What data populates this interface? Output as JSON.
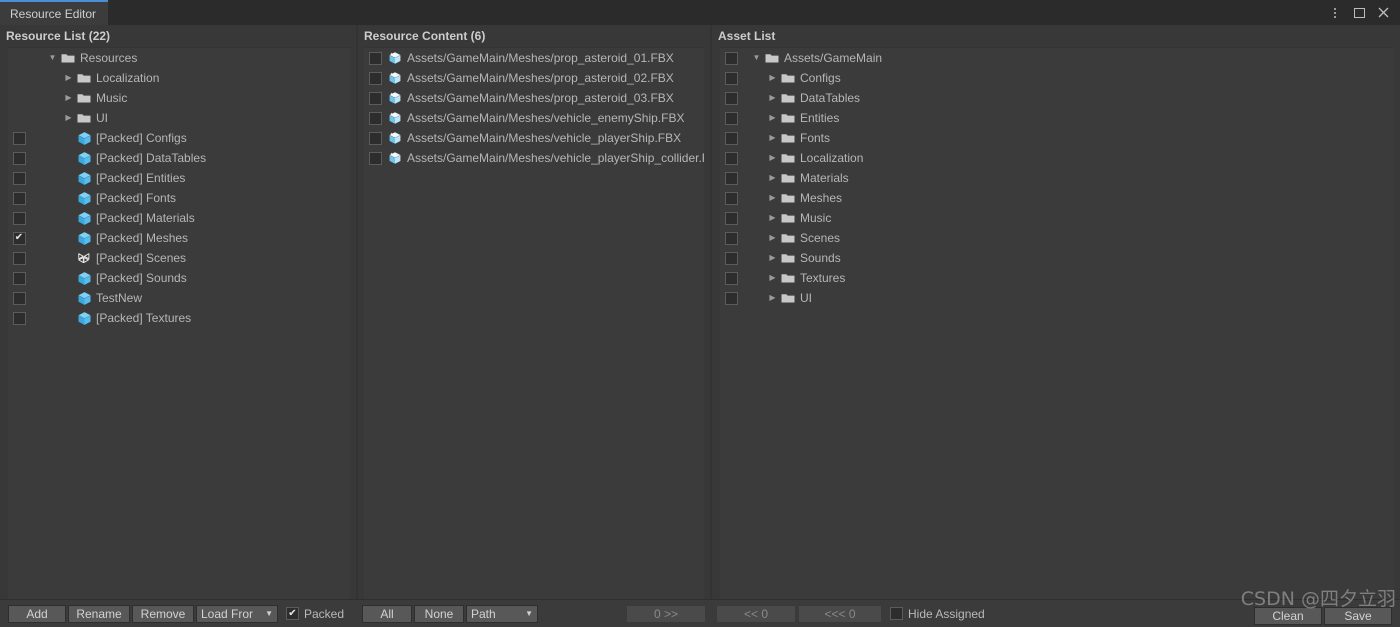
{
  "window": {
    "tab_label": "Resource Editor",
    "accent_color": "#4a8fd6",
    "controls": [
      {
        "name": "more-options",
        "glyph": "kebab"
      },
      {
        "name": "maximize",
        "glyph": "square"
      },
      {
        "name": "close",
        "glyph": "✕"
      }
    ]
  },
  "panels": {
    "resource_list": {
      "title": "Resource List (22)",
      "rows": [
        {
          "label": "Resources",
          "icon": "folder-icon",
          "indent": 1,
          "triangle": "down",
          "checkbox": null
        },
        {
          "label": "Localization",
          "icon": "folder-icon",
          "indent": 2,
          "triangle": "right",
          "checkbox": null
        },
        {
          "label": "Music",
          "icon": "folder-icon",
          "indent": 2,
          "triangle": "right",
          "checkbox": null
        },
        {
          "label": "UI",
          "icon": "folder-icon",
          "indent": 2,
          "triangle": "right",
          "checkbox": null
        },
        {
          "label": "[Packed] Configs",
          "icon": "prefab-icon",
          "indent": 2,
          "triangle": "none",
          "checkbox": false
        },
        {
          "label": "[Packed] DataTables",
          "icon": "prefab-icon",
          "indent": 2,
          "triangle": "none",
          "checkbox": false
        },
        {
          "label": "[Packed] Entities",
          "icon": "prefab-icon",
          "indent": 2,
          "triangle": "none",
          "checkbox": false
        },
        {
          "label": "[Packed] Fonts",
          "icon": "prefab-icon",
          "indent": 2,
          "triangle": "none",
          "checkbox": false
        },
        {
          "label": "[Packed] Materials",
          "icon": "prefab-icon",
          "indent": 2,
          "triangle": "none",
          "checkbox": false
        },
        {
          "label": "[Packed] Meshes",
          "icon": "prefab-icon",
          "indent": 2,
          "triangle": "none",
          "checkbox": true
        },
        {
          "label": "[Packed] Scenes",
          "icon": "unity-icon",
          "indent": 2,
          "triangle": "none",
          "checkbox": false
        },
        {
          "label": "[Packed] Sounds",
          "icon": "prefab-icon",
          "indent": 2,
          "triangle": "none",
          "checkbox": false
        },
        {
          "label": "TestNew",
          "icon": "prefab-icon",
          "indent": 2,
          "triangle": "none",
          "checkbox": false
        },
        {
          "label": "[Packed] Textures",
          "icon": "prefab-icon",
          "indent": 2,
          "triangle": "none",
          "checkbox": false
        }
      ],
      "toolbar": {
        "add_label": "Add",
        "rename_label": "Rename",
        "remove_label": "Remove",
        "load_from_label": "Load Fror",
        "packed_label": "Packed",
        "packed_checked": true
      }
    },
    "resource_content": {
      "title": "Resource Content (6)",
      "rows": [
        {
          "label": "Assets/GameMain/Meshes/prop_asteroid_01.FBX",
          "icon": "model-icon",
          "checkbox": false
        },
        {
          "label": "Assets/GameMain/Meshes/prop_asteroid_02.FBX",
          "icon": "model-icon",
          "checkbox": false
        },
        {
          "label": "Assets/GameMain/Meshes/prop_asteroid_03.FBX",
          "icon": "model-icon",
          "checkbox": false
        },
        {
          "label": "Assets/GameMain/Meshes/vehicle_enemyShip.FBX",
          "icon": "model-icon",
          "checkbox": false
        },
        {
          "label": "Assets/GameMain/Meshes/vehicle_playerShip.FBX",
          "icon": "model-icon",
          "checkbox": false
        },
        {
          "label": "Assets/GameMain/Meshes/vehicle_playerShip_collider.FBX",
          "icon": "model-icon",
          "checkbox": false
        }
      ],
      "toolbar": {
        "all_label": "All",
        "none_label": "None",
        "path_label": "Path",
        "assign_label": "0 >>",
        "assign_disabled": true
      }
    },
    "asset_list": {
      "title": "Asset List",
      "rows": [
        {
          "label": "Assets/GameMain",
          "icon": "folder-icon",
          "indent": 0,
          "triangle": "down",
          "checkbox": false
        },
        {
          "label": "Configs",
          "icon": "folder-icon",
          "indent": 1,
          "triangle": "right",
          "checkbox": false
        },
        {
          "label": "DataTables",
          "icon": "folder-icon",
          "indent": 1,
          "triangle": "right",
          "checkbox": false
        },
        {
          "label": "Entities",
          "icon": "folder-icon",
          "indent": 1,
          "triangle": "right",
          "checkbox": false
        },
        {
          "label": "Fonts",
          "icon": "folder-icon",
          "indent": 1,
          "triangle": "right",
          "checkbox": false
        },
        {
          "label": "Localization",
          "icon": "folder-icon",
          "indent": 1,
          "triangle": "right",
          "checkbox": false
        },
        {
          "label": "Materials",
          "icon": "folder-icon",
          "indent": 1,
          "triangle": "right",
          "checkbox": false
        },
        {
          "label": "Meshes",
          "icon": "folder-icon",
          "indent": 1,
          "triangle": "right",
          "checkbox": false
        },
        {
          "label": "Music",
          "icon": "folder-icon",
          "indent": 1,
          "triangle": "right",
          "checkbox": false
        },
        {
          "label": "Scenes",
          "icon": "folder-icon",
          "indent": 1,
          "triangle": "right",
          "checkbox": false
        },
        {
          "label": "Sounds",
          "icon": "folder-icon",
          "indent": 1,
          "triangle": "right",
          "checkbox": false
        },
        {
          "label": "Textures",
          "icon": "folder-icon",
          "indent": 1,
          "triangle": "right",
          "checkbox": false
        },
        {
          "label": "UI",
          "icon": "folder-icon",
          "indent": 1,
          "triangle": "right",
          "checkbox": false
        }
      ],
      "toolbar": {
        "unassign_label": "<< 0",
        "unassign_all_label": "<<< 0",
        "unassign_disabled": true,
        "hide_assigned_label": "Hide Assigned",
        "hide_assigned_checked": false,
        "clean_label": "Clean",
        "save_label": "Save"
      }
    }
  },
  "watermark": "CSDN @四夕立羽"
}
